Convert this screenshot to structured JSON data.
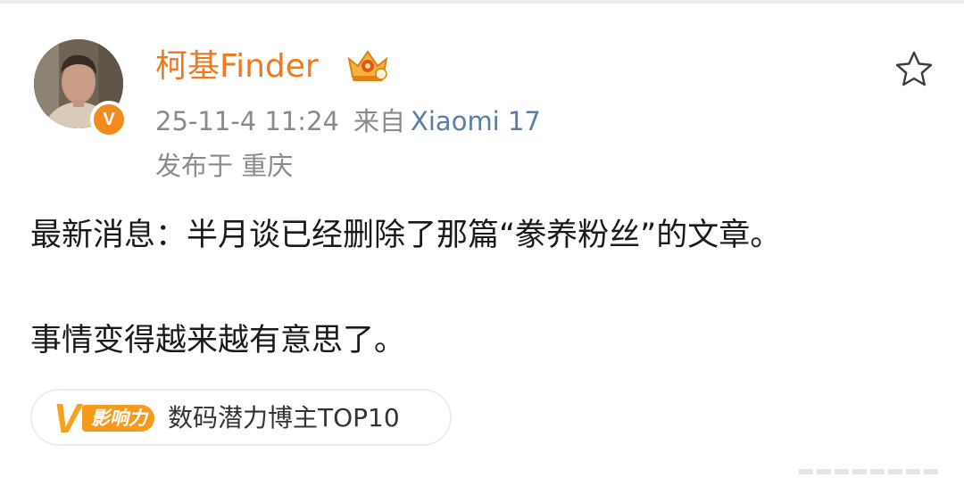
{
  "post": {
    "author": {
      "username": "柯基Finder",
      "verified_label": "V"
    },
    "meta": {
      "time": "25-11-4 11:24",
      "from_label": "来自",
      "device": "Xiaomi 17",
      "location": "发布于 重庆"
    },
    "content": {
      "paragraph1": "最新消息：半月谈已经删除了那篇“豢养粉丝”的文章。",
      "paragraph2": "事情变得越来越有意思了。"
    },
    "influence_tag": {
      "badge_letter": "V",
      "badge_text": "影响力",
      "label": "数码潜力博主TOP10"
    }
  },
  "icons": {
    "favorite": "star-outline-icon",
    "member_crown": "crown-badge-icon"
  },
  "colors": {
    "username": "#f0781e",
    "meta_text": "#8a8a8a",
    "device_link": "#5b7ca7",
    "body_text": "#1a1a1a",
    "badge_orange": "#f59a1c"
  }
}
